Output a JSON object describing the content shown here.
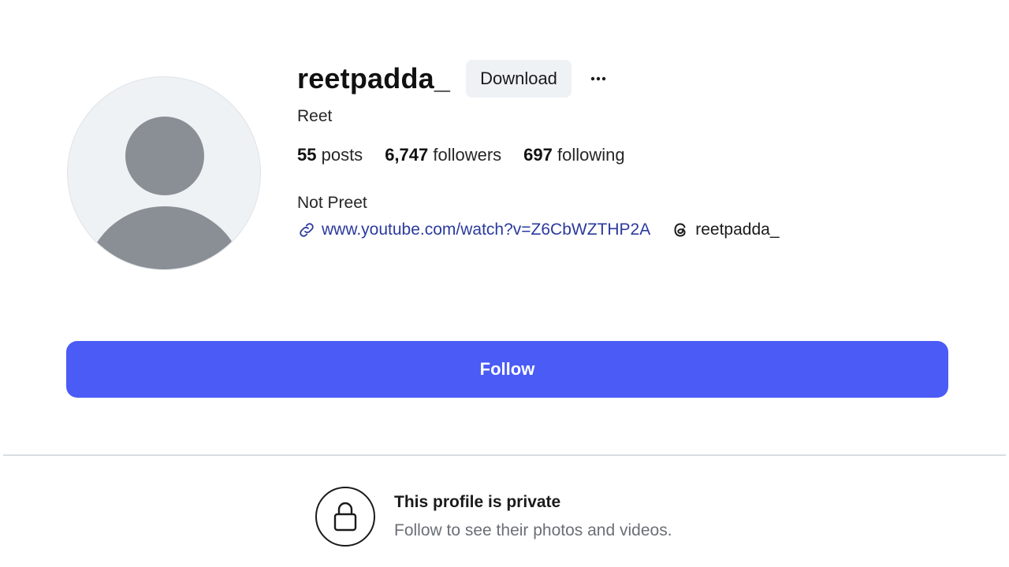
{
  "profile": {
    "username": "reetpadda_",
    "display_name": "Reet",
    "bio": "Not Preet",
    "avatar_icon": "default-avatar-icon"
  },
  "header": {
    "download_label": "Download",
    "more_icon": "more-horizontal-icon"
  },
  "stats": [
    {
      "count": "55",
      "label": " posts"
    },
    {
      "count": "6,747",
      "label": " followers"
    },
    {
      "count": "697",
      "label": " following"
    }
  ],
  "links": {
    "link_icon": "link-icon",
    "url": "www.youtube.com/watch?v=Z6CbWZTHP2A",
    "threads_icon": "threads-icon",
    "threads_handle": "reetpadda_"
  },
  "follow_label": "Follow",
  "private": {
    "lock_icon": "lock-icon",
    "title": "This profile is private",
    "subtitle": "Follow to see their photos and videos."
  },
  "colors": {
    "accent": "#4a5bf6",
    "link": "#2b3a9e",
    "avatar_bg": "#eff2f5",
    "avatar_fg": "#8a8f96"
  }
}
